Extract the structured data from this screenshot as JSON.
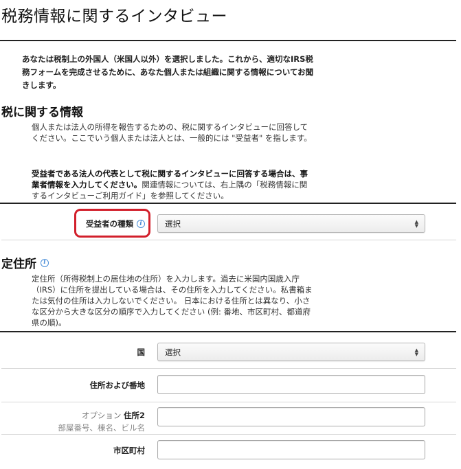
{
  "header": {
    "title": "税務情報に関するインタビュー"
  },
  "intro": {
    "text": "あなたは税制上の外国人（米国人以外）を選択しました。これから、適切なIRS税務フォームを完成させるために、あなた個人または組織に関する情報についてお聞きします。"
  },
  "tax_info": {
    "heading": "税に関する情報",
    "paragraph1": "個人または法人の所得を報告するための、税に関するインタビューに回答してください。ここでいう個人または法人とは、一般的には \"受益者\" を指します。",
    "paragraph2_bold": "受益者である法人の代表として税に関するインタビューに回答する場合は、事業者情報を入力してください。",
    "paragraph2_rest": "関連情報については、右上隅の「税務情報に関するインタビューご利用ガイド」を参照してください。"
  },
  "beneficiary_type": {
    "label": "受益者の種類",
    "info_icon_glyph": "i",
    "selected": "選択"
  },
  "address": {
    "heading": "定住所",
    "info_icon_glyph": "i",
    "paragraph": "定住所（所得税制上の居住地の住所）を入力します。過去に米国内国歳入庁（IRS）に住所を提出している場合は、その住所を入力してください。私書箱または気付の住所は入力しないでください。 日本における住所とは異なり、小さな区分から大きな区分の順序で入力してください (例: 番地、市区町村、都道府県の順)。",
    "country": {
      "label": "国",
      "selected": "選択"
    },
    "address_line1": {
      "label": "住所および番地",
      "value": ""
    },
    "address_line2": {
      "optional": "オプション",
      "label": "住所2",
      "hint": "部屋番号、棟名、ビル名",
      "value": ""
    },
    "city": {
      "label": "市区町村",
      "value": ""
    }
  },
  "colors": {
    "highlight": "#d21f2b",
    "info_icon": "#4a8ed8",
    "rule": "#222222"
  }
}
